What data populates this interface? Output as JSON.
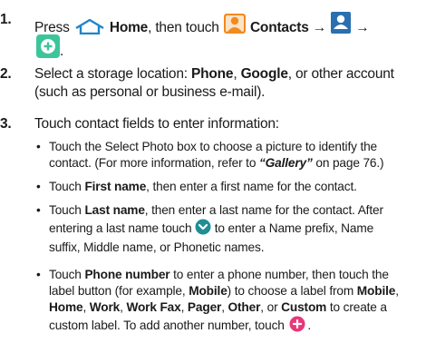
{
  "steps": [
    {
      "number": "1.",
      "press": "Press",
      "home": "Home",
      "then_touch": ", then touch",
      "contacts": "Contacts",
      "arrow1": "→",
      "contacts_icon_caption": "Contacts",
      "arrow2": "→",
      "end": "."
    },
    {
      "number": "2.",
      "line1_a": "Select a storage location:",
      "phone": "Phone",
      "comma1": ",",
      "google": "Google",
      "line1_b": ", or other account",
      "line2": "(such as personal or business e-mail)."
    },
    {
      "number": "3.",
      "text": "Touch contact fields to enter information:"
    }
  ],
  "bullets": {
    "b1_line1": "Touch the Select Photo box to choose a picture to identify the",
    "b1_line2_a": "contact. (For more information, refer to",
    "b1_ref": "“Gallery”",
    "b1_line2_b": "on page 76.)",
    "b2_a": "Touch",
    "b2_kw": "First name",
    "b2_b": ", then enter a first name for the contact.",
    "b3_a": "Touch",
    "b3_kw": "Last name",
    "b3_b": ", then enter a last name for the contact. After",
    "b3_line2_a": "entering a last name touch",
    "b3_line2_b": "to enter a Name prefix, Name",
    "b3_line3": "suffix, Middle name, or Phonetic names.",
    "b4_a": "Touch",
    "b4_kw": "Phone number",
    "b4_b": "to enter a phone number, then touch the",
    "b4_line2_a": "label button (for example,",
    "b4_mobile1": "Mobile",
    "b4_line2_b": ") to choose a label from",
    "b4_mobile2": "Mobile",
    "b4_comma0": ",",
    "b4_home": "Home",
    "b4_c1": ",",
    "b4_work": "Work",
    "b4_c2": ",",
    "b4_workfax": "Work Fax",
    "b4_c3": ",",
    "b4_pager": "Pager",
    "b4_c4": ",",
    "b4_other": "Other",
    "b4_or": ", or",
    "b4_custom": "Custom",
    "b4_line3_b": "to create a",
    "b4_line4_a": "custom label. To add another number, touch",
    "b4_end": "."
  },
  "bullet_glyph": "•",
  "icons": [
    "home-icon",
    "contacts-app-icon",
    "contacts-small-icon",
    "add-contact-icon",
    "expand-chevron-icon",
    "add-field-icon"
  ],
  "colors": {
    "contacts_orange": "#f28a1e",
    "add_green": "#3cc59a",
    "chevron_teal": "#1f8f94",
    "plus_pink": "#e8377a"
  }
}
